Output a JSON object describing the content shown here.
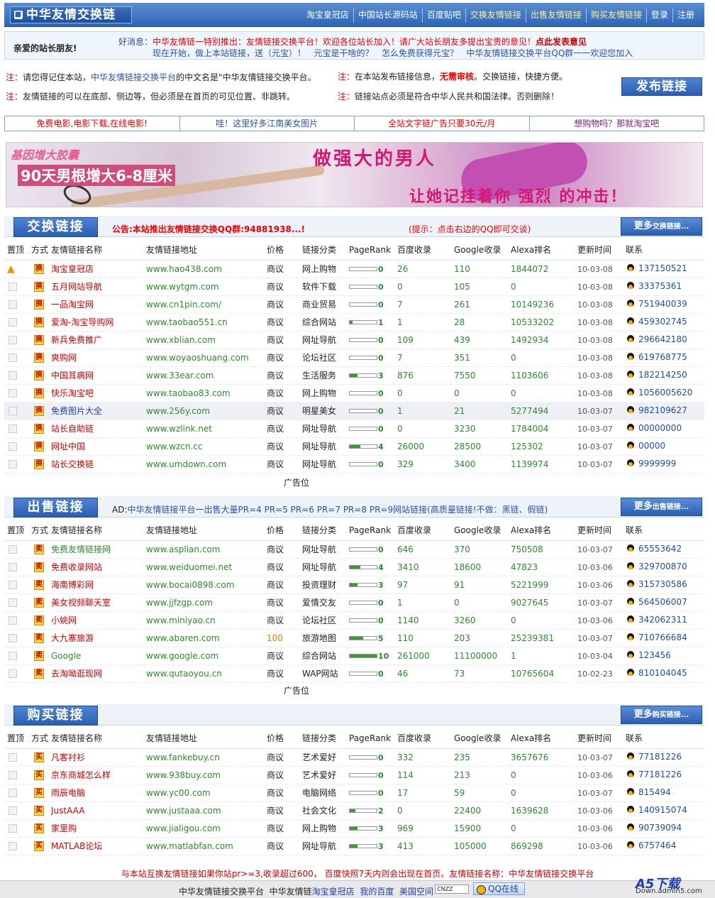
{
  "header": {
    "logo": "中华友情交换链",
    "nav": [
      "淘宝皇冠店",
      "中国站长源码站",
      "百度贴吧",
      "交换友情链接",
      "出售友情链接",
      "购买友情链接",
      "登录",
      "注册"
    ]
  },
  "news": {
    "hello": "亲爱的站长朋友!",
    "label": "好消息：",
    "line1": "中华友情链一特别推出：友情链接交换平台！欢迎各位站长加入！请广大站长朋友多提出宝贵的意见！",
    "line1_link": "点此发表意见",
    "line2": [
      "现在开始，做上本站链接，送（元宝）！",
      "元宝是干啥的？",
      "怎么免费获得元宝？",
      "中华友情链接交换平台QQ群一一欢迎您加入"
    ]
  },
  "notes": {
    "n1a": "注：",
    "n1b": "请您得记住本站，",
    "n1c": "中华友情链接交换平台",
    "n1d": "的中文名是\"中华友情链接交换平台。",
    "n2a": "注：",
    "n2b": "友情链接的可以在底部、侧边等，但必须是在首页的可见位置、非跳转。",
    "n3a": "注：",
    "n3b": "在本站发布链接信息，",
    "n3c": "无需审核",
    "n3d": "。交换链接，快捷方便。",
    "n4a": "注：",
    "n4b": "链接站点必须是符合中华人民共和国法律。否则删除！",
    "publish": "发布链接"
  },
  "text_ads": [
    "免费电影,电影下载,在线电影!",
    "哇！这里好多江南美女图片",
    "全站文字链广告只要30元/月",
    "想购物吗？那就淘宝吧"
  ],
  "banner": {
    "t1": "基因增大胶囊",
    "t2": "90天男根增大6-8厘米",
    "t3": "做强大的男人",
    "t4": "让她记挂着你 强烈 的冲击！"
  },
  "columns": [
    "置顶",
    "方式",
    "友情链接名称",
    "友情链接地址",
    "价格",
    "链接分类",
    "PageRank",
    "百度收录",
    "Google收录",
    "Alexa排名",
    "更新时间",
    "联系"
  ],
  "sections": {
    "exchange": {
      "title": "交换链接",
      "ann": "公告:本站推出友情链接交换QQ群:94881938...!",
      "tip": "(提示：点击右边的QQ即可交谈)",
      "more": "更多",
      "more_small": "交换链接...",
      "kind": "换",
      "rows": [
        {
          "top": true,
          "name": "淘宝皇冠店",
          "url": "www.hao438.com",
          "price": "商议",
          "cat": "网上购物",
          "pr": 0,
          "baidu": "26",
          "google": "110",
          "alexa": "1844072",
          "date": "10-03-08",
          "qq": "137150521",
          "c": "r"
        },
        {
          "name": "五月网站导航",
          "url": "www.wytgm.com",
          "price": "商议",
          "cat": "软件下载",
          "pr": 0,
          "baidu": "0",
          "google": "105",
          "alexa": "0",
          "date": "10-03-08",
          "qq": "33375361",
          "c": "r"
        },
        {
          "name": "一品淘宝网",
          "url": "www.cn1pin.com/",
          "price": "商议",
          "cat": "商业贸易",
          "pr": 0,
          "baidu": "7",
          "google": "261",
          "alexa": "10149236",
          "date": "10-03-08",
          "qq": "751940039",
          "c": "r"
        },
        {
          "name": "爱淘-淘宝导购网",
          "url": "www.taobao551.cn",
          "price": "商议",
          "cat": "综合网站",
          "pr": 1,
          "baidu": "1",
          "google": "28",
          "alexa": "10533202",
          "date": "10-03-08",
          "qq": "459302745",
          "c": "r"
        },
        {
          "name": "新兵免费推广",
          "url": "www.xblian.com",
          "price": "商议",
          "cat": "网址导航",
          "pr": 0,
          "baidu": "109",
          "google": "439",
          "alexa": "1492934",
          "date": "10-03-08",
          "qq": "296642180",
          "c": "r"
        },
        {
          "name": "爽购网",
          "url": "www.woyaoshuang.com",
          "price": "商议",
          "cat": "论坛社区",
          "pr": 0,
          "baidu": "7",
          "google": "351",
          "alexa": "0",
          "date": "10-03-08",
          "qq": "619768775",
          "c": "r"
        },
        {
          "name": "中国耳病网",
          "url": "www.33ear.com",
          "price": "商议",
          "cat": "生活服务",
          "pr": 3,
          "baidu": "876",
          "google": "7550",
          "alexa": "1103606",
          "date": "10-03-08",
          "qq": "182214250",
          "c": "r"
        },
        {
          "name": "快乐淘宝吧",
          "url": "www.taobao83.com",
          "price": "商议",
          "cat": "网上购物",
          "pr": 0,
          "baidu": "0",
          "google": "0",
          "alexa": "0",
          "date": "10-03-08",
          "qq": "1056005620",
          "c": "r"
        },
        {
          "hi": true,
          "name": "免费图片大全",
          "url": "www.256y.com",
          "price": "商议",
          "cat": "明星美女",
          "pr": 0,
          "baidu": "1",
          "google": "21",
          "alexa": "5277494",
          "date": "10-03-07",
          "qq": "982109627",
          "c": "b"
        },
        {
          "name": "站长自助链",
          "url": "www.wzlink.net",
          "price": "商议",
          "cat": "网址导航",
          "pr": 0,
          "baidu": "0",
          "google": "3230",
          "alexa": "1784004",
          "date": "10-03-07",
          "qq": "00000000",
          "c": "r"
        },
        {
          "name": "网址中国",
          "url": "www.wzcn.cc",
          "price": "商议",
          "cat": "网址导航",
          "pr": 4,
          "baidu": "26000",
          "google": "28500",
          "alexa": "125302",
          "date": "10-03-07",
          "qq": "00000",
          "c": "r"
        },
        {
          "name": "站长交换链",
          "url": "www.umdown.com",
          "price": "商议",
          "cat": "网址导航",
          "pr": 0,
          "baidu": "329",
          "google": "3400",
          "alexa": "1139974",
          "date": "10-03-07",
          "qq": "9999999",
          "c": "r"
        }
      ],
      "adpos": "广告位"
    },
    "sell": {
      "title": "出售链接",
      "ann_a": "AD:",
      "ann_b": "中华友情链接平台一出售大量PR=4 PR=5 PR=6 PR=7 PR=8 PR=9网站链接(高质量链接!不做：黑链、假链)",
      "more": "更多",
      "more_small": "出售链接...",
      "kind": "卖",
      "rows": [
        {
          "name": "免费友情链接网",
          "url": "www.asplian.com",
          "price": "商议",
          "cat": "网址导航",
          "pr": 0,
          "baidu": "646",
          "google": "370",
          "alexa": "750508",
          "date": "10-03-07",
          "qq": "65553642",
          "c": "g"
        },
        {
          "name": "免费收录网站",
          "url": "www.weiduomei.net",
          "price": "商议",
          "cat": "网址导航",
          "pr": 4,
          "baidu": "3410",
          "google": "18600",
          "alexa": "47823",
          "date": "10-03-06",
          "qq": "329700870",
          "c": "r"
        },
        {
          "name": "海南博彩网",
          "url": "www.bocai0898.com",
          "price": "商议",
          "cat": "投资理财",
          "pr": 3,
          "baidu": "97",
          "google": "91",
          "alexa": "5221999",
          "date": "10-03-06",
          "qq": "315730586",
          "c": "r"
        },
        {
          "name": "美女视频聊天室",
          "url": "www.jjfzgp.com",
          "price": "商议",
          "cat": "爱情交友",
          "pr": 0,
          "baidu": "1",
          "google": "0",
          "alexa": "9027645",
          "date": "10-03-07",
          "qq": "564506007",
          "c": "r"
        },
        {
          "name": "小姚网",
          "url": "www.miniyao.cn",
          "price": "商议",
          "cat": "论坛社区",
          "pr": 0,
          "baidu": "1140",
          "google": "3260",
          "alexa": "0",
          "date": "10-03-06",
          "qq": "342062311",
          "c": "r"
        },
        {
          "name": "大九寨旅游",
          "url": "www.abaren.com",
          "price": "100",
          "cat": "旅游地图",
          "pr": 5,
          "baidu": "110",
          "google": "203",
          "alexa": "25239381",
          "date": "10-03-07",
          "qq": "710766684",
          "c": "r"
        },
        {
          "name": "Google",
          "url": "www.google.com",
          "price": "商议",
          "cat": "综合网站",
          "pr": 10,
          "baidu": "261000",
          "google": "11100000",
          "alexa": "1",
          "date": "10-03-04",
          "qq": "123456",
          "c": "g"
        },
        {
          "name": "去淘呦逛现网",
          "url": "www.qutaoyou.cn",
          "price": "商议",
          "cat": "WAP网站",
          "pr": 0,
          "baidu": "46",
          "google": "73",
          "alexa": "10765604",
          "date": "10-02-23",
          "qq": "810104045",
          "c": "r"
        }
      ],
      "adpos": "广告位"
    },
    "buy": {
      "title": "购买链接",
      "more": "更多",
      "more_small": "购买链接...",
      "kind": "买",
      "rows": [
        {
          "name": "凡客衬衫",
          "url": "www.fankebuy.cn",
          "price": "商议",
          "cat": "艺术爱好",
          "pr": 0,
          "baidu": "332",
          "google": "235",
          "alexa": "3657676",
          "date": "10-03-07",
          "qq": "77181226",
          "c": "r"
        },
        {
          "name": "京东商城怎么样",
          "url": "www.938buy.com",
          "price": "商议",
          "cat": "艺术爱好",
          "pr": 0,
          "baidu": "114",
          "google": "213",
          "alexa": "0",
          "date": "10-03-06",
          "qq": "77181226",
          "c": "r"
        },
        {
          "name": "雨辰电脑",
          "url": "www.yc00.com",
          "price": "商议",
          "cat": "电脑网络",
          "pr": 0,
          "baidu": "17",
          "google": "59",
          "alexa": "0",
          "date": "10-03-07",
          "qq": "815494",
          "c": "r"
        },
        {
          "name": "JustAAA",
          "url": "www.justaaa.com",
          "price": "商议",
          "cat": "社会文化",
          "pr": 2,
          "baidu": "0",
          "google": "22400",
          "alexa": "1639628",
          "date": "10-03-06",
          "qq": "140915074",
          "c": "r"
        },
        {
          "name": "家里购",
          "url": "www.jialigou.com",
          "price": "商议",
          "cat": "网上购物",
          "pr": 3,
          "baidu": "969",
          "google": "15900",
          "alexa": "0",
          "date": "10-03-06",
          "qq": "90739094",
          "c": "r"
        },
        {
          "name": "MATLAB论坛",
          "url": "www.matlabfan.com",
          "price": "商议",
          "cat": "网址导航",
          "pr": 3,
          "baidu": "413",
          "google": "105000",
          "alexa": "869298",
          "date": "10-03-06",
          "qq": "6757464",
          "c": "r"
        }
      ]
    }
  },
  "footer": {
    "note": "与本站互换友情链接如果你站pr>=3,收录超过600， 百度快照7天内则会出现在首页。友情链接名称：中华友情链接交换平台",
    "links_a": "中华友情链接交换平台",
    "links_b": "中华友情链",
    "links_c": "淘宝皇冠店",
    "links_d": "我的百度",
    "links_e": "美国空间",
    "badge": "CNZZ",
    "qq_online": "QQ在线",
    "wm1": "A5下载",
    "wm2": "Down.admin5.com"
  }
}
